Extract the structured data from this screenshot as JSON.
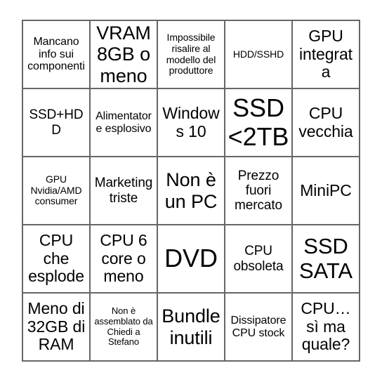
{
  "card": {
    "type": "bingo-card",
    "rows": 5,
    "columns": 5,
    "border_color": "#666666",
    "background_color": "#ffffff",
    "text_color": "#000000",
    "cells": [
      {
        "text": "Mancano info sui componenti",
        "size": "xs"
      },
      {
        "text": "VRAM 8GB o meno",
        "size": "lg"
      },
      {
        "text": "Impossibile risalire al modello del produttore",
        "size": "xxs"
      },
      {
        "text": "HDD/SSHD",
        "size": "xxs"
      },
      {
        "text": "GPU integrata",
        "size": "md"
      },
      {
        "text": "SSD+HDD",
        "size": "sm"
      },
      {
        "text": "Alimentatore esplosivo",
        "size": "xs"
      },
      {
        "text": "Windows 10",
        "size": "md"
      },
      {
        "text": "SSD <2TB",
        "size": "xxl"
      },
      {
        "text": "CPU vecchia",
        "size": "md"
      },
      {
        "text": "GPU Nvidia/AMD consumer",
        "size": "xxs"
      },
      {
        "text": "Marketing triste",
        "size": "sm"
      },
      {
        "text": "Non è un PC",
        "size": "lg"
      },
      {
        "text": "Prezzo fuori mercato",
        "size": "sm"
      },
      {
        "text": "MiniPC",
        "size": "md"
      },
      {
        "text": "CPU che esplode",
        "size": "md"
      },
      {
        "text": "CPU 6 core o meno",
        "size": "md"
      },
      {
        "text": "DVD",
        "size": "xxl"
      },
      {
        "text": "CPU obsoleta",
        "size": "sm"
      },
      {
        "text": "SSD SATA",
        "size": "xl"
      },
      {
        "text": "Meno di 32GB di RAM",
        "size": "md"
      },
      {
        "text": "Non è assemblato da Chiedi a Stefano",
        "size": "tiny"
      },
      {
        "text": "Bundle inutili",
        "size": "lg"
      },
      {
        "text": "Dissipatore CPU stock",
        "size": "xs"
      },
      {
        "text": "CPU… sì ma quale?",
        "size": "md"
      }
    ]
  }
}
